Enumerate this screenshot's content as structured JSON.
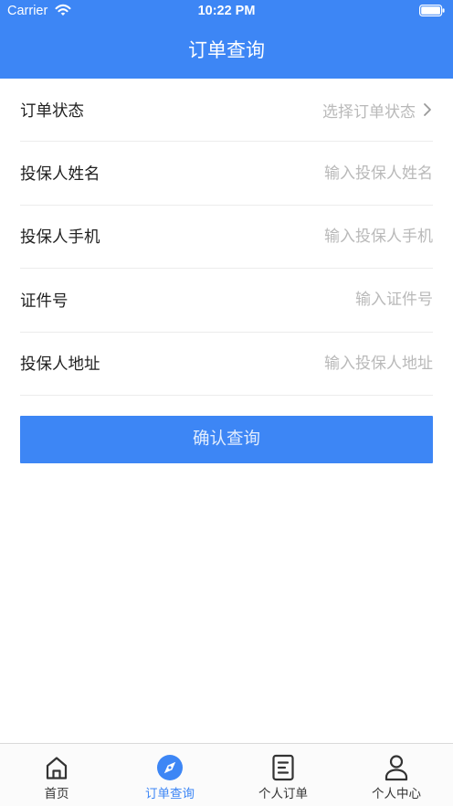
{
  "status_bar": {
    "carrier": "Carrier",
    "time": "10:22 PM",
    "wifi_icon": "wifi-icon",
    "battery_icon": "battery-icon"
  },
  "header": {
    "title": "订单查询"
  },
  "form": {
    "status": {
      "label": "订单状态",
      "placeholder": "选择订单状态",
      "icon": "chevron-right-icon"
    },
    "fields": [
      {
        "label": "投保人姓名",
        "placeholder": "输入投保人姓名",
        "value": ""
      },
      {
        "label": "投保人手机",
        "placeholder": "输入投保人手机",
        "value": ""
      },
      {
        "label": "证件号",
        "placeholder": "输入证件号",
        "value": ""
      },
      {
        "label": "投保人地址",
        "placeholder": "输入投保人地址",
        "value": ""
      }
    ],
    "submit_label": "确认查询"
  },
  "tabbar": {
    "items": [
      {
        "label": "首页",
        "icon": "home-icon",
        "active": false
      },
      {
        "label": "订单查询",
        "icon": "compass-icon",
        "active": true
      },
      {
        "label": "个人订单",
        "icon": "document-icon",
        "active": false
      },
      {
        "label": "个人中心",
        "icon": "person-icon",
        "active": false
      }
    ]
  },
  "colors": {
    "primary": "#3d86f5",
    "label": "#222222",
    "placeholder": "#b9b9b9",
    "divider": "#ececec",
    "tab_icon": "#333333"
  }
}
